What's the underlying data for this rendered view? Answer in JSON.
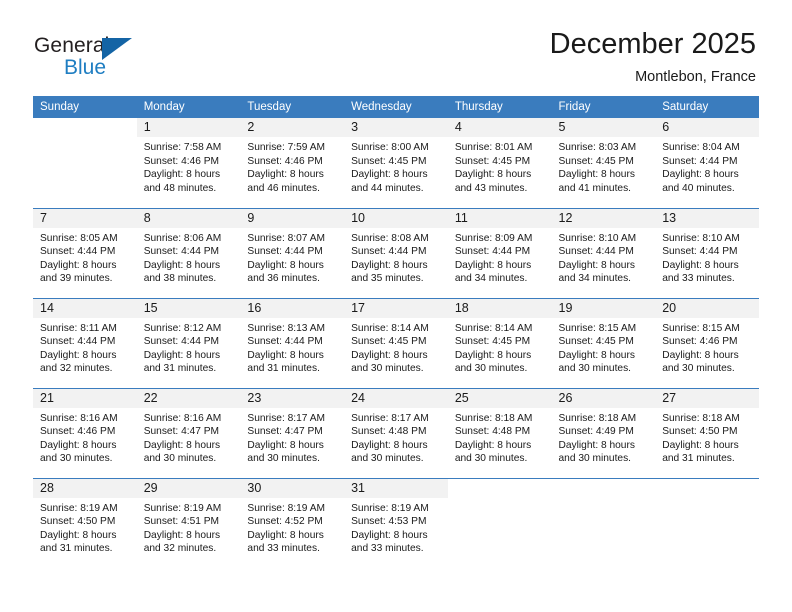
{
  "brand": {
    "name_part1": "General",
    "name_part2": "Blue",
    "accent_color": "#1f7ec2",
    "triangle_color": "#1464a5"
  },
  "header": {
    "title": "December 2025",
    "subtitle": "Montlebon, France"
  },
  "calendar": {
    "header_bg": "#3a7cbe",
    "daynum_bg": "#f2f2f2",
    "weekday_headers": [
      "Sunday",
      "Monday",
      "Tuesday",
      "Wednesday",
      "Thursday",
      "Friday",
      "Saturday"
    ],
    "weeks": [
      [
        {
          "day": "",
          "sunrise": "",
          "sunset": "",
          "daylight_line1": "",
          "daylight_line2": "",
          "empty": true
        },
        {
          "day": "1",
          "sunrise": "Sunrise: 7:58 AM",
          "sunset": "Sunset: 4:46 PM",
          "daylight_line1": "Daylight: 8 hours",
          "daylight_line2": "and 48 minutes."
        },
        {
          "day": "2",
          "sunrise": "Sunrise: 7:59 AM",
          "sunset": "Sunset: 4:46 PM",
          "daylight_line1": "Daylight: 8 hours",
          "daylight_line2": "and 46 minutes."
        },
        {
          "day": "3",
          "sunrise": "Sunrise: 8:00 AM",
          "sunset": "Sunset: 4:45 PM",
          "daylight_line1": "Daylight: 8 hours",
          "daylight_line2": "and 44 minutes."
        },
        {
          "day": "4",
          "sunrise": "Sunrise: 8:01 AM",
          "sunset": "Sunset: 4:45 PM",
          "daylight_line1": "Daylight: 8 hours",
          "daylight_line2": "and 43 minutes."
        },
        {
          "day": "5",
          "sunrise": "Sunrise: 8:03 AM",
          "sunset": "Sunset: 4:45 PM",
          "daylight_line1": "Daylight: 8 hours",
          "daylight_line2": "and 41 minutes."
        },
        {
          "day": "6",
          "sunrise": "Sunrise: 8:04 AM",
          "sunset": "Sunset: 4:44 PM",
          "daylight_line1": "Daylight: 8 hours",
          "daylight_line2": "and 40 minutes."
        }
      ],
      [
        {
          "day": "7",
          "sunrise": "Sunrise: 8:05 AM",
          "sunset": "Sunset: 4:44 PM",
          "daylight_line1": "Daylight: 8 hours",
          "daylight_line2": "and 39 minutes."
        },
        {
          "day": "8",
          "sunrise": "Sunrise: 8:06 AM",
          "sunset": "Sunset: 4:44 PM",
          "daylight_line1": "Daylight: 8 hours",
          "daylight_line2": "and 38 minutes."
        },
        {
          "day": "9",
          "sunrise": "Sunrise: 8:07 AM",
          "sunset": "Sunset: 4:44 PM",
          "daylight_line1": "Daylight: 8 hours",
          "daylight_line2": "and 36 minutes."
        },
        {
          "day": "10",
          "sunrise": "Sunrise: 8:08 AM",
          "sunset": "Sunset: 4:44 PM",
          "daylight_line1": "Daylight: 8 hours",
          "daylight_line2": "and 35 minutes."
        },
        {
          "day": "11",
          "sunrise": "Sunrise: 8:09 AM",
          "sunset": "Sunset: 4:44 PM",
          "daylight_line1": "Daylight: 8 hours",
          "daylight_line2": "and 34 minutes."
        },
        {
          "day": "12",
          "sunrise": "Sunrise: 8:10 AM",
          "sunset": "Sunset: 4:44 PM",
          "daylight_line1": "Daylight: 8 hours",
          "daylight_line2": "and 34 minutes."
        },
        {
          "day": "13",
          "sunrise": "Sunrise: 8:10 AM",
          "sunset": "Sunset: 4:44 PM",
          "daylight_line1": "Daylight: 8 hours",
          "daylight_line2": "and 33 minutes."
        }
      ],
      [
        {
          "day": "14",
          "sunrise": "Sunrise: 8:11 AM",
          "sunset": "Sunset: 4:44 PM",
          "daylight_line1": "Daylight: 8 hours",
          "daylight_line2": "and 32 minutes."
        },
        {
          "day": "15",
          "sunrise": "Sunrise: 8:12 AM",
          "sunset": "Sunset: 4:44 PM",
          "daylight_line1": "Daylight: 8 hours",
          "daylight_line2": "and 31 minutes."
        },
        {
          "day": "16",
          "sunrise": "Sunrise: 8:13 AM",
          "sunset": "Sunset: 4:44 PM",
          "daylight_line1": "Daylight: 8 hours",
          "daylight_line2": "and 31 minutes."
        },
        {
          "day": "17",
          "sunrise": "Sunrise: 8:14 AM",
          "sunset": "Sunset: 4:45 PM",
          "daylight_line1": "Daylight: 8 hours",
          "daylight_line2": "and 30 minutes."
        },
        {
          "day": "18",
          "sunrise": "Sunrise: 8:14 AM",
          "sunset": "Sunset: 4:45 PM",
          "daylight_line1": "Daylight: 8 hours",
          "daylight_line2": "and 30 minutes."
        },
        {
          "day": "19",
          "sunrise": "Sunrise: 8:15 AM",
          "sunset": "Sunset: 4:45 PM",
          "daylight_line1": "Daylight: 8 hours",
          "daylight_line2": "and 30 minutes."
        },
        {
          "day": "20",
          "sunrise": "Sunrise: 8:15 AM",
          "sunset": "Sunset: 4:46 PM",
          "daylight_line1": "Daylight: 8 hours",
          "daylight_line2": "and 30 minutes."
        }
      ],
      [
        {
          "day": "21",
          "sunrise": "Sunrise: 8:16 AM",
          "sunset": "Sunset: 4:46 PM",
          "daylight_line1": "Daylight: 8 hours",
          "daylight_line2": "and 30 minutes."
        },
        {
          "day": "22",
          "sunrise": "Sunrise: 8:16 AM",
          "sunset": "Sunset: 4:47 PM",
          "daylight_line1": "Daylight: 8 hours",
          "daylight_line2": "and 30 minutes."
        },
        {
          "day": "23",
          "sunrise": "Sunrise: 8:17 AM",
          "sunset": "Sunset: 4:47 PM",
          "daylight_line1": "Daylight: 8 hours",
          "daylight_line2": "and 30 minutes."
        },
        {
          "day": "24",
          "sunrise": "Sunrise: 8:17 AM",
          "sunset": "Sunset: 4:48 PM",
          "daylight_line1": "Daylight: 8 hours",
          "daylight_line2": "and 30 minutes."
        },
        {
          "day": "25",
          "sunrise": "Sunrise: 8:18 AM",
          "sunset": "Sunset: 4:48 PM",
          "daylight_line1": "Daylight: 8 hours",
          "daylight_line2": "and 30 minutes."
        },
        {
          "day": "26",
          "sunrise": "Sunrise: 8:18 AM",
          "sunset": "Sunset: 4:49 PM",
          "daylight_line1": "Daylight: 8 hours",
          "daylight_line2": "and 30 minutes."
        },
        {
          "day": "27",
          "sunrise": "Sunrise: 8:18 AM",
          "sunset": "Sunset: 4:50 PM",
          "daylight_line1": "Daylight: 8 hours",
          "daylight_line2": "and 31 minutes."
        }
      ],
      [
        {
          "day": "28",
          "sunrise": "Sunrise: 8:19 AM",
          "sunset": "Sunset: 4:50 PM",
          "daylight_line1": "Daylight: 8 hours",
          "daylight_line2": "and 31 minutes."
        },
        {
          "day": "29",
          "sunrise": "Sunrise: 8:19 AM",
          "sunset": "Sunset: 4:51 PM",
          "daylight_line1": "Daylight: 8 hours",
          "daylight_line2": "and 32 minutes."
        },
        {
          "day": "30",
          "sunrise": "Sunrise: 8:19 AM",
          "sunset": "Sunset: 4:52 PM",
          "daylight_line1": "Daylight: 8 hours",
          "daylight_line2": "and 33 minutes."
        },
        {
          "day": "31",
          "sunrise": "Sunrise: 8:19 AM",
          "sunset": "Sunset: 4:53 PM",
          "daylight_line1": "Daylight: 8 hours",
          "daylight_line2": "and 33 minutes."
        },
        {
          "day": "",
          "sunrise": "",
          "sunset": "",
          "daylight_line1": "",
          "daylight_line2": "",
          "empty": true
        },
        {
          "day": "",
          "sunrise": "",
          "sunset": "",
          "daylight_line1": "",
          "daylight_line2": "",
          "empty": true
        },
        {
          "day": "",
          "sunrise": "",
          "sunset": "",
          "daylight_line1": "",
          "daylight_line2": "",
          "empty": true
        }
      ]
    ]
  }
}
